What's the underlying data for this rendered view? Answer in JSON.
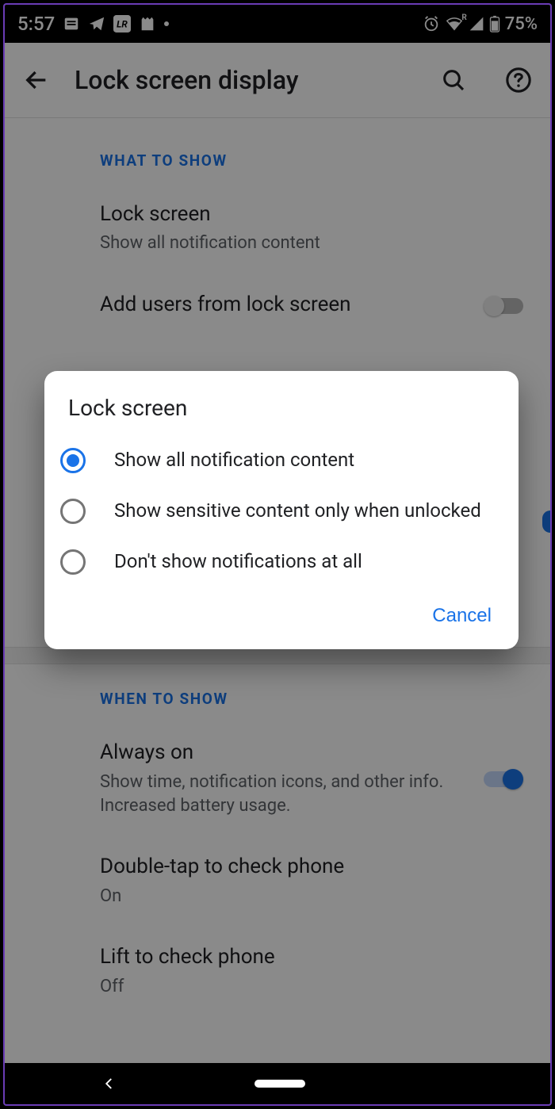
{
  "status": {
    "time": "5:57",
    "battery": "75%",
    "r_tag": "R"
  },
  "appbar": {
    "title": "Lock screen display"
  },
  "sections": {
    "what_header": "WHAT TO SHOW",
    "lock": {
      "title": "Lock screen",
      "sub": "Show all notification content"
    },
    "add_users": {
      "title": "Add users from lock screen"
    },
    "when_header": "WHEN TO SHOW",
    "always_on": {
      "title": "Always on",
      "sub": "Show time, notification icons, and other info. Increased battery usage."
    },
    "double_tap": {
      "title": "Double-tap to check phone",
      "sub": "On"
    },
    "lift": {
      "title": "Lift to check phone",
      "sub": "Off"
    }
  },
  "dialog": {
    "title": "Lock screen",
    "opt1": "Show all notification content",
    "opt2": "Show sensitive content only when unlocked",
    "opt3": "Don't show notifications at all",
    "cancel": "Cancel"
  }
}
